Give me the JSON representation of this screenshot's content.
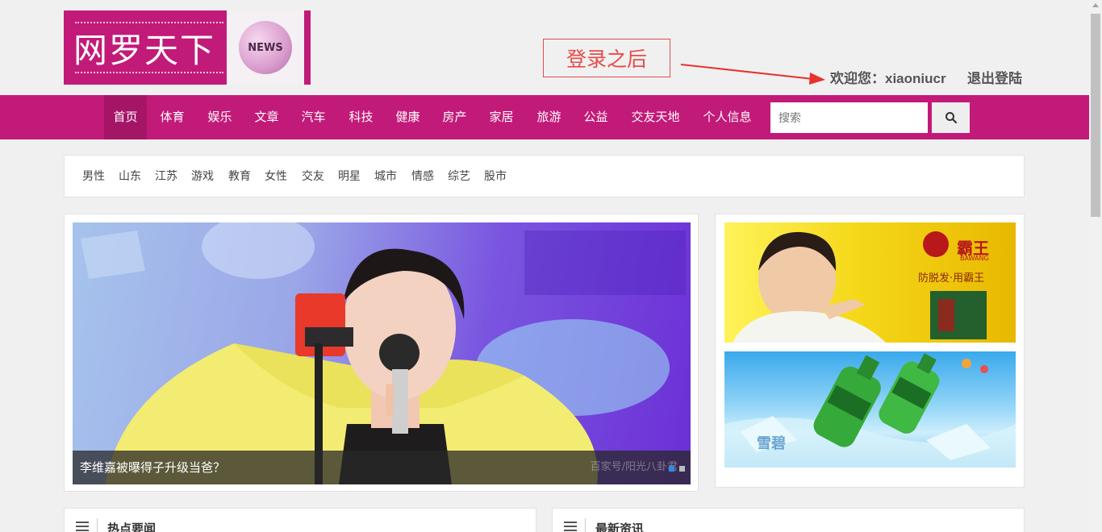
{
  "header": {
    "logo_text": "网罗天下",
    "logo_badge": "NEWS",
    "annotation": "登录之后",
    "welcome": "欢迎您：xiaoniucr",
    "logout": "退出登陆"
  },
  "nav": {
    "items": [
      "首页",
      "体育",
      "娱乐",
      "文章",
      "汽车",
      "科技",
      "健康",
      "房产",
      "家居",
      "旅游",
      "公益",
      "交友天地",
      "个人信息"
    ],
    "search_placeholder": "搜索",
    "accent": "#c21a78"
  },
  "tags": [
    "男性",
    "山东",
    "江苏",
    "游戏",
    "教育",
    "女性",
    "交友",
    "明星",
    "城市",
    "情感",
    "综艺",
    "股市"
  ],
  "slider": {
    "caption": "李维嘉被曝得子升级当爸？",
    "watermark": "百家号/阳光八卦君"
  },
  "ads": {
    "ad1_brand": "霸王",
    "ad1_brand_en": "BAWANG",
    "ad1_slogan": "防脱发·用霸王",
    "ad2_text": "雪碧"
  },
  "panels": {
    "hot_news": "热点要闻",
    "latest": "最新资讯"
  }
}
